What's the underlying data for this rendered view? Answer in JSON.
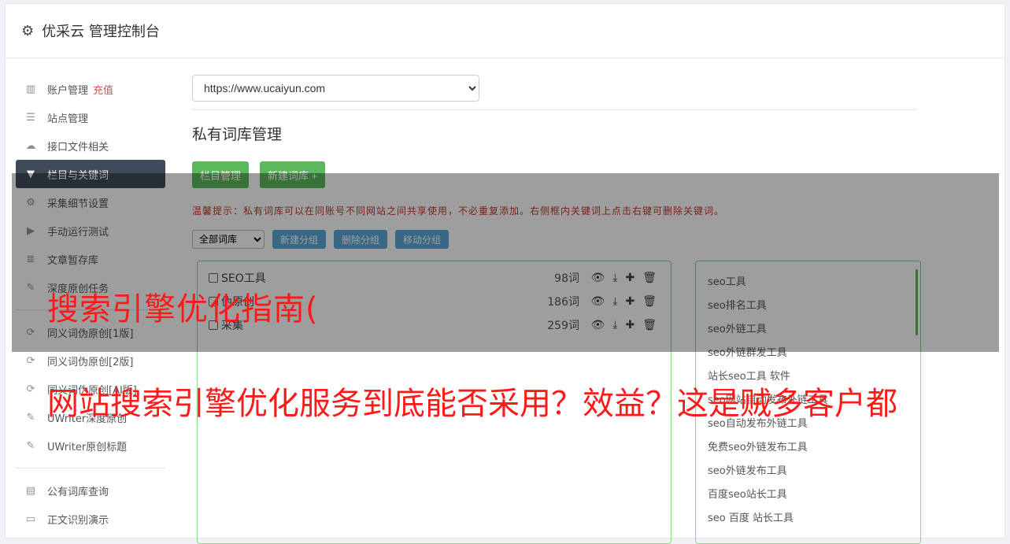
{
  "header": {
    "title": "优采云 管理控制台",
    "icon": "gear-icon"
  },
  "sidebar": {
    "group1": [
      {
        "label": "账户管理",
        "extra": "充值",
        "icon": "bar-chart-icon"
      },
      {
        "label": "站点管理",
        "icon": "server-icon"
      },
      {
        "label": "接口文件相关",
        "icon": "cloud-upload-icon"
      },
      {
        "label": "栏目与关键词",
        "icon": "filter-icon",
        "active": true
      },
      {
        "label": "采集细节设置",
        "icon": "gears-icon"
      },
      {
        "label": "手动运行测试",
        "icon": "play-circle-icon"
      },
      {
        "label": "文章暂存库",
        "icon": "database-icon"
      },
      {
        "label": "深度原创任务",
        "icon": "edit-icon"
      }
    ],
    "group2": [
      {
        "label": "同义词伪原创[1版]",
        "icon": "refresh-icon"
      },
      {
        "label": "同义词伪原创[2版]",
        "icon": "refresh-icon"
      },
      {
        "label": "同义词伪原创[AI版]",
        "icon": "refresh-icon"
      },
      {
        "label": "UWriter深度原创",
        "icon": "edit-icon"
      },
      {
        "label": "UWriter原创标题",
        "icon": "edit-icon"
      }
    ],
    "group3": [
      {
        "label": "公有词库查询",
        "icon": "book-icon"
      },
      {
        "label": "正文识别演示",
        "icon": "monitor-icon"
      }
    ]
  },
  "main": {
    "site_select": {
      "value": "https://www.ucaiyun.com",
      "options": [
        "https://www.ucaiyun.com"
      ]
    },
    "section_title": "私有词库管理",
    "buttons": {
      "columns": "栏目管理",
      "new_lib": "新建词库 +"
    },
    "tip": "温馨提示：私有词库可以在同账号不同网站之间共享使用，不必重复添加。右侧框内关键词上点击右键可删除关键词。",
    "filter_select": {
      "value": "全部词库",
      "options": [
        "全部词库"
      ]
    },
    "group_buttons": {
      "new_group": "新建分组",
      "delete_group": "删除分组",
      "move_group": "移动分组"
    },
    "libraries": [
      {
        "name": "SEO工具",
        "count": "98词"
      },
      {
        "name": "伪原创",
        "count": "186词"
      },
      {
        "name": "采集",
        "count": "259词"
      }
    ],
    "keywords": [
      "seo工具",
      "seo排名工具",
      "seo外链工具",
      "seo外链群发工具",
      "站长seo工具 软件",
      "seo网站自动发布外链工具",
      "seo自动发布外链工具",
      "免费seo外链发布工具",
      "seo外链发布工具",
      "百度seo站长工具",
      "seo 百度 站长工具"
    ]
  },
  "overlay": {
    "headline1": "搜索引擎优化指南(",
    "headline2": "网站搜索引擎优化服务到底能否采用？效益？这是贼多客户都"
  },
  "colors": {
    "active_nav": "#3f4b5a",
    "green": "#5cb85c",
    "blue": "#5ba8d8",
    "tip": "#c0392b",
    "headline": "#ff1a1a"
  }
}
